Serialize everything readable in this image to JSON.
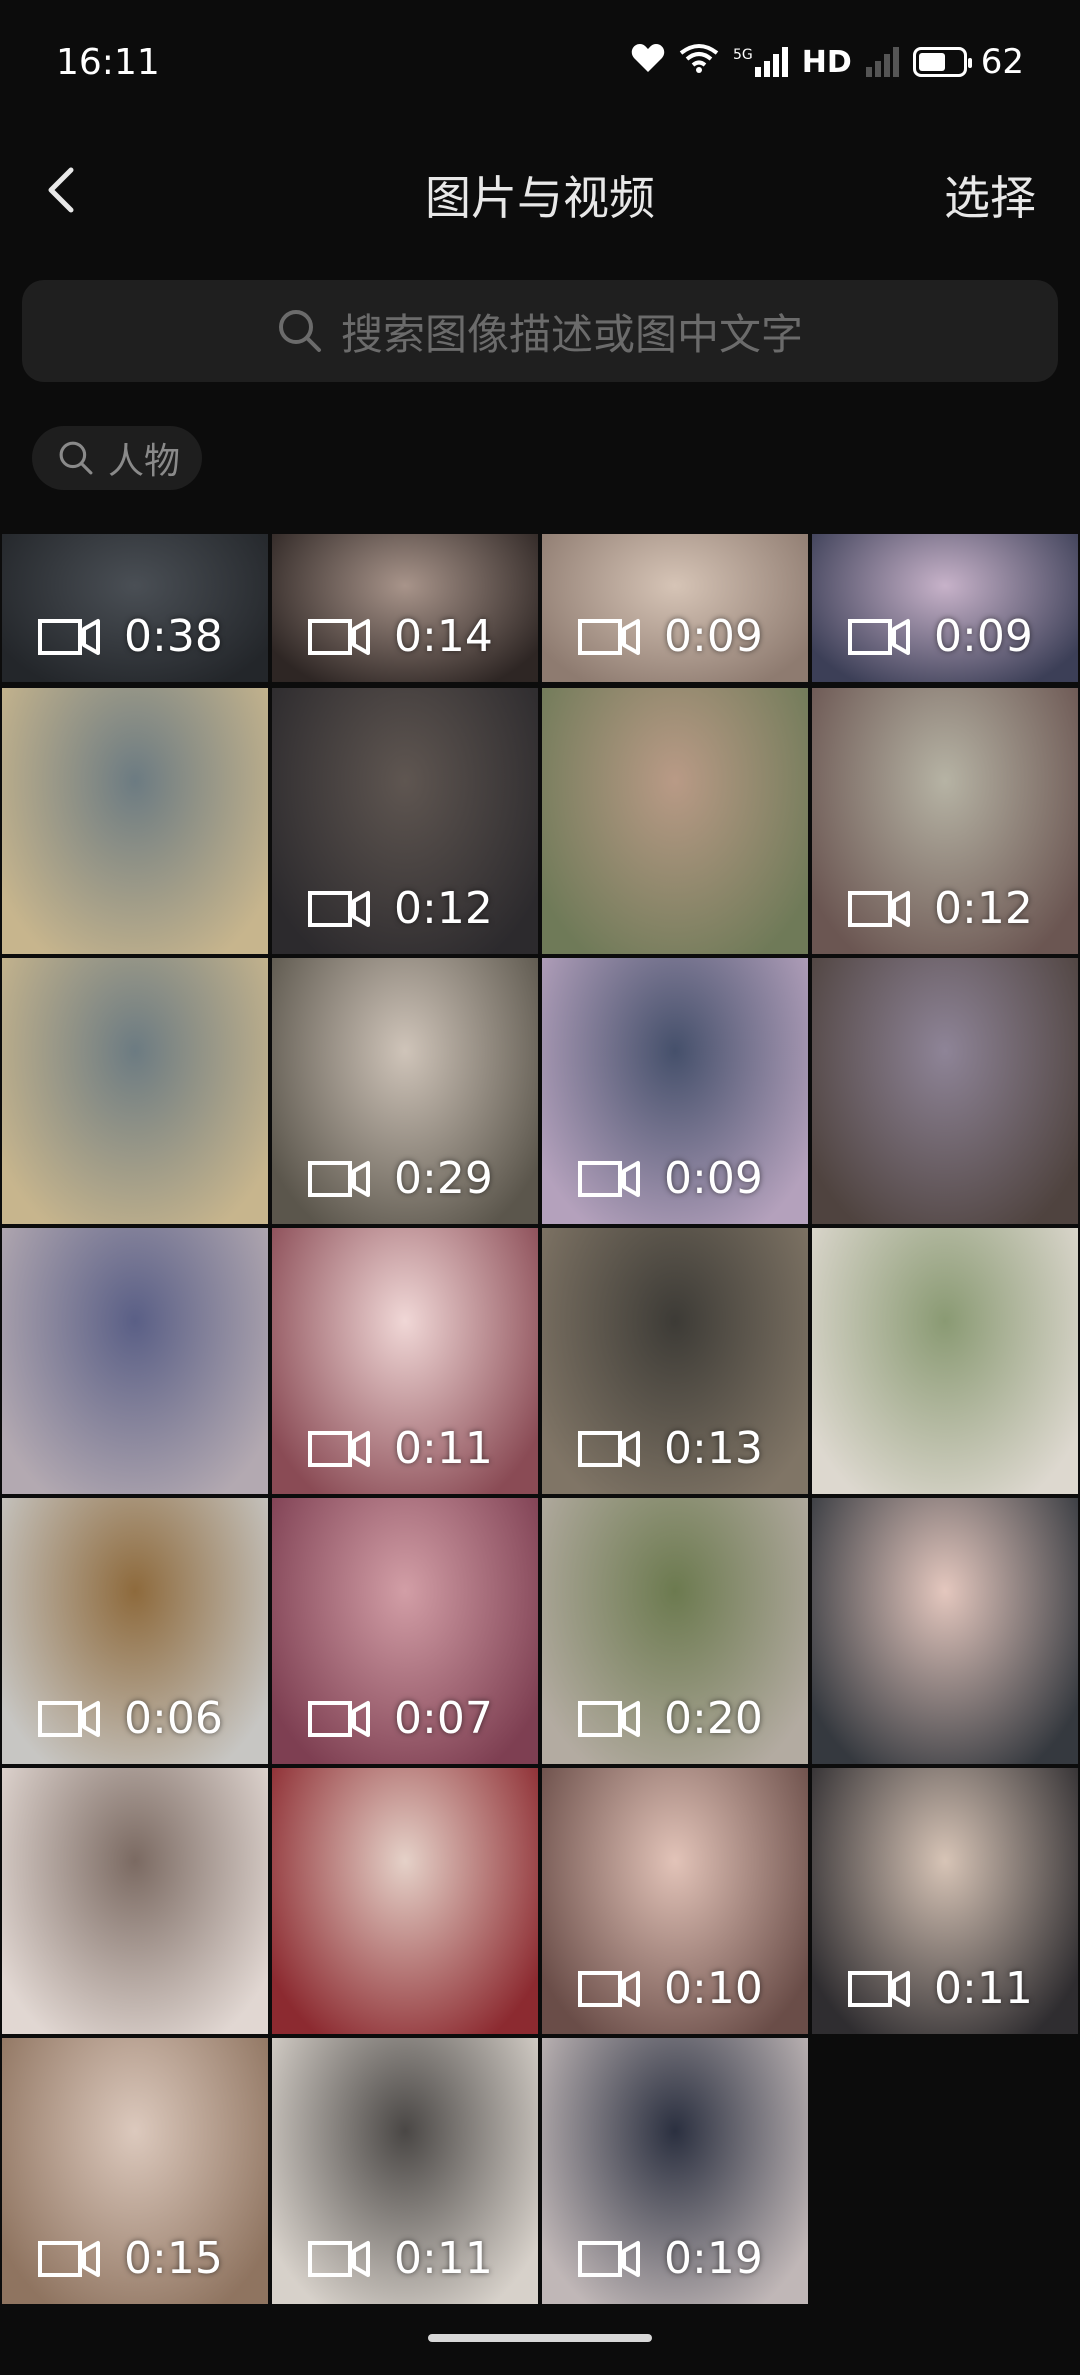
{
  "status": {
    "time": "16:11",
    "network": "5G",
    "hd": "HD",
    "battery": "62",
    "battery_level": 0.62
  },
  "nav": {
    "title": "图片与视频",
    "select": "选择"
  },
  "search": {
    "placeholder": "搜索图像描述或图中文字"
  },
  "chip": {
    "label": "人物"
  },
  "tiles": [
    {
      "duration": "0:38",
      "c1": "#4a4f55",
      "c2": "#23262a"
    },
    {
      "duration": "0:14",
      "c1": "#a8948a",
      "c2": "#2e2624"
    },
    {
      "duration": "0:09",
      "c1": "#d6c4b6",
      "c2": "#8e7b70"
    },
    {
      "duration": "0:09",
      "c1": "#c7b2c9",
      "c2": "#3c3f57"
    },
    {
      "duration": "",
      "c1": "#6c7b82",
      "c2": "#c7b58d"
    },
    {
      "duration": "0:12",
      "c1": "#5f5651",
      "c2": "#2c2a2d"
    },
    {
      "duration": "",
      "c1": "#b99a86",
      "c2": "#6f7a58"
    },
    {
      "duration": "0:12",
      "c1": "#b6b3a4",
      "c2": "#6b5652"
    },
    {
      "duration": "",
      "c1": "#6c7b82",
      "c2": "#c7b58d"
    },
    {
      "duration": "0:29",
      "c1": "#cfc4b9",
      "c2": "#5b564c"
    },
    {
      "duration": "0:09",
      "c1": "#45506b",
      "c2": "#b4a1bc"
    },
    {
      "duration": "",
      "c1": "#8e8497",
      "c2": "#4f433f"
    },
    {
      "duration": "",
      "c1": "#5a5f86",
      "c2": "#b3a9b1"
    },
    {
      "duration": "0:11",
      "c1": "#f0d7d6",
      "c2": "#8a4b55"
    },
    {
      "duration": "0:13",
      "c1": "#3d3b36",
      "c2": "#807566"
    },
    {
      "duration": "",
      "c1": "#8a9a73",
      "c2": "#ddd8cf"
    },
    {
      "duration": "0:06",
      "c1": "#8e6a3c",
      "c2": "#c7c6c3"
    },
    {
      "duration": "0:07",
      "c1": "#d29ea6",
      "c2": "#7e3f52"
    },
    {
      "duration": "0:20",
      "c1": "#6c7a4f",
      "c2": "#b3aba1"
    },
    {
      "duration": "",
      "c1": "#e4c7be",
      "c2": "#35393f"
    },
    {
      "duration": "",
      "c1": "#7b6a62",
      "c2": "#e1d7d2"
    },
    {
      "duration": "",
      "c1": "#e5d1c8",
      "c2": "#8c2a30"
    },
    {
      "duration": "0:10",
      "c1": "#e2c3b8",
      "c2": "#6a4d48"
    },
    {
      "duration": "0:11",
      "c1": "#d7c4b6",
      "c2": "#2f2d30"
    },
    {
      "duration": "0:15",
      "c1": "#dcc9bd",
      "c2": "#8f7460"
    },
    {
      "duration": "0:11",
      "c1": "#4a4745",
      "c2": "#d7d1ca"
    },
    {
      "duration": "0:19",
      "c1": "#2b3040",
      "c2": "#c0b7b7"
    }
  ]
}
